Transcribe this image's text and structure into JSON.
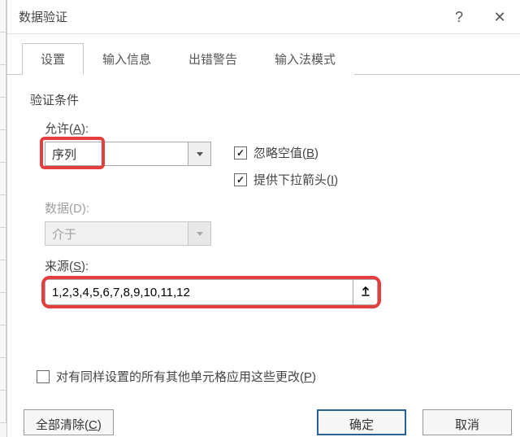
{
  "titlebar": {
    "title": "数据验证"
  },
  "tabs": {
    "items": [
      {
        "label": "设置"
      },
      {
        "label": "输入信息"
      },
      {
        "label": "出错警告"
      },
      {
        "label": "输入法模式"
      }
    ]
  },
  "validation": {
    "section_label": "验证条件",
    "allow_label_pre": "允许(",
    "allow_label_u": "A",
    "allow_label_post": "):",
    "allow_value": "序列",
    "data_label": "数据(D):",
    "data_value": "介于",
    "ignore_blank_pre": "忽略空值(",
    "ignore_blank_u": "B",
    "ignore_blank_post": ")",
    "dropdown_pre": "提供下拉箭头(",
    "dropdown_u": "I",
    "dropdown_post": ")",
    "source_label_pre": "来源(",
    "source_label_u": "S",
    "source_label_post": "):",
    "source_value": "1,2,3,4,5,6,7,8,9,10,11,12"
  },
  "apply": {
    "label_pre": "对有同样设置的所有其他单元格应用这些更改(",
    "label_u": "P",
    "label_post": ")"
  },
  "footer": {
    "clear_pre": "全部清除(",
    "clear_u": "C",
    "clear_post": ")",
    "ok": "确定",
    "cancel": "取消"
  }
}
